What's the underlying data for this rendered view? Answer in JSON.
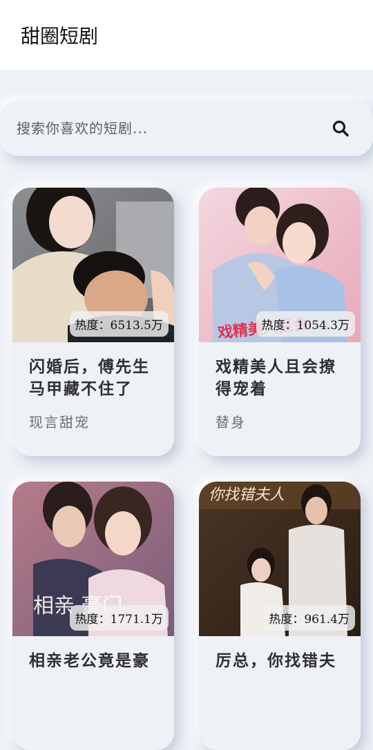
{
  "app": {
    "title": "甜圈短剧"
  },
  "search": {
    "placeholder": "搜索你喜欢的短剧..."
  },
  "cards": [
    {
      "heat": "热度：6513.5万",
      "title": "闪婚后，傅先生马甲藏不住了",
      "tag": "现言甜宠",
      "poster_text": ""
    },
    {
      "heat": "热度：1054.3万",
      "title": "戏精美人且会撩得宠着",
      "tag": "替身",
      "poster_text": "戏精美人且会"
    },
    {
      "heat": "热度：1771.1万",
      "title": "相亲老公竟是豪",
      "tag": "",
      "poster_text": "相亲 豪门"
    },
    {
      "heat": "热度：961.4万",
      "title": "厉总，你找错夫",
      "tag": "",
      "poster_text": "你找错夫人"
    }
  ]
}
